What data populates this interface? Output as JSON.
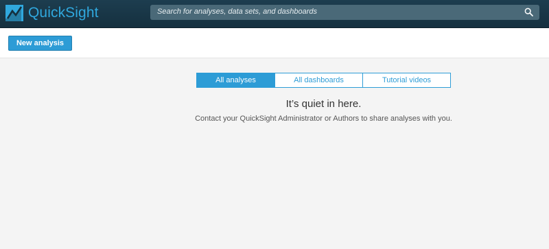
{
  "app": {
    "brand": "QuickSight",
    "logo_icon": "quicksight-logo-icon",
    "brand_color": "#30a8de"
  },
  "search": {
    "placeholder": "Search for analyses, data sets, and dashboards",
    "icon": "search-icon"
  },
  "toolbar": {
    "new_analysis_label": "New analysis"
  },
  "tabs": [
    {
      "label": "All analyses",
      "active": true
    },
    {
      "label": "All dashboards",
      "active": false
    },
    {
      "label": "Tutorial videos",
      "active": false
    }
  ],
  "empty_state": {
    "title": "It’s quiet in here.",
    "message": "Contact your QuickSight Administrator or Authors to share analyses with you."
  },
  "colors": {
    "accent": "#2d9cd6",
    "header_bg": "#1d3d4f",
    "search_bg": "#4a6978"
  }
}
